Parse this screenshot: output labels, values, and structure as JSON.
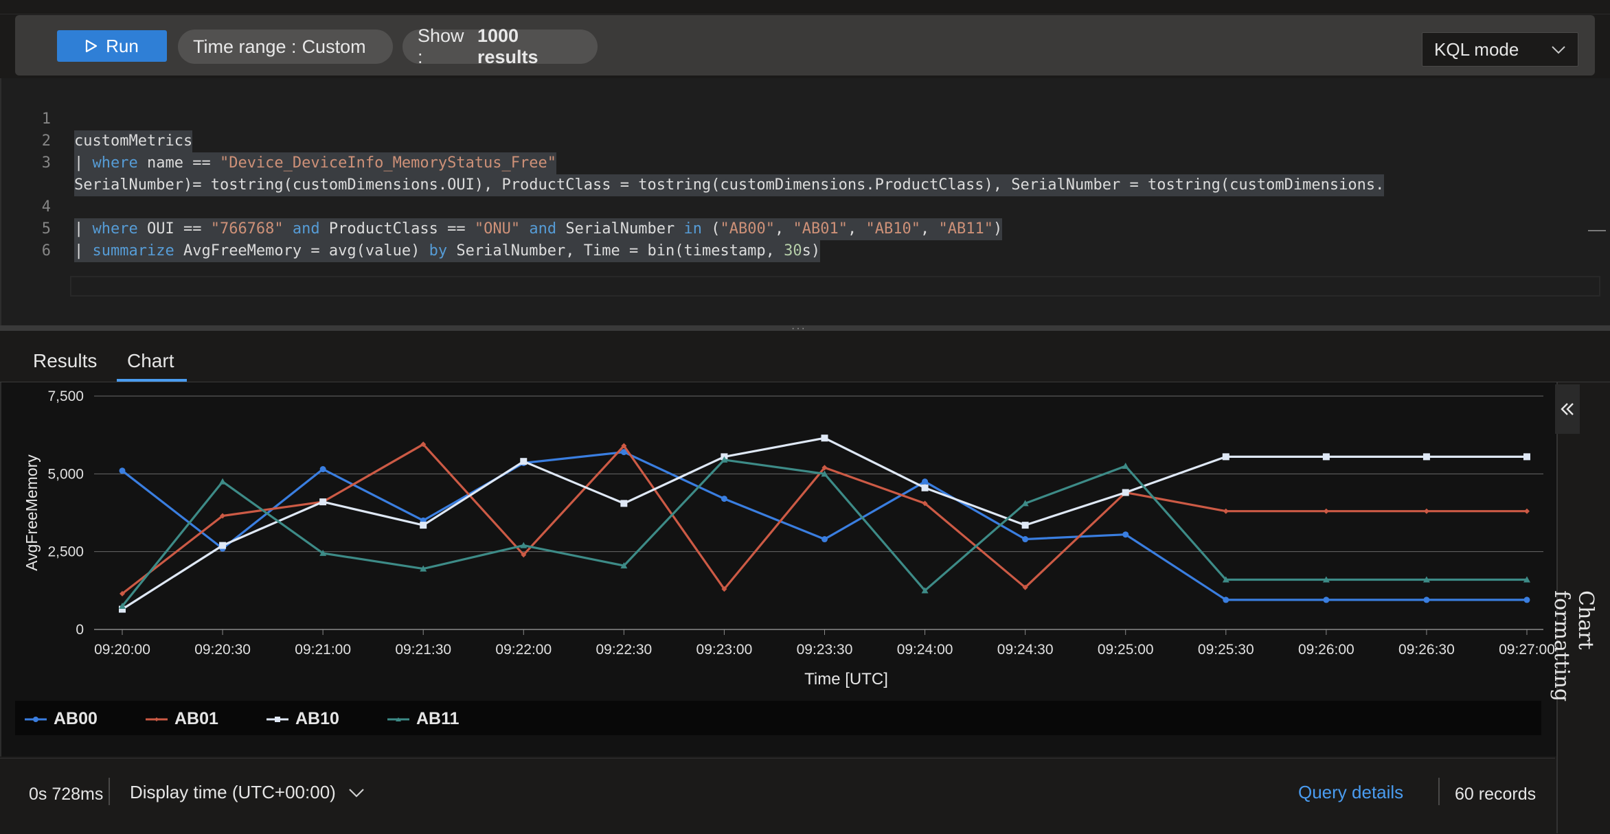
{
  "toolbar": {
    "run_label": "Run",
    "time_range_label": "Time range :",
    "time_range_value": "Custom",
    "show_label": "Show :",
    "show_value": "1000 results",
    "mode_value": "KQL mode"
  },
  "editor": {
    "line_numbers": [
      "1",
      "2",
      "3",
      "4",
      "5",
      "6"
    ],
    "code_lines": [
      "customMetrics",
      "| where name == \"Device_DeviceInfo_MemoryStatus_Free\"",
      "| extend OUI = tostring(customDimensions.OUI), ProductClass = tostring(customDimensions.ProductClass), SerialNumber = tostring(customDimensions.",
      "SerialNumber)",
      "| where OUI == \"766768\" and ProductClass == \"ONU\" and SerialNumber in (\"AB00\", \"AB01\", \"AB10\", \"AB11\")",
      "| summarize AvgFreeMemory = avg(value) by SerialNumber, Time = bin(timestamp, 30s)",
      ""
    ]
  },
  "tabs": [
    {
      "label": "Results",
      "active": false
    },
    {
      "label": "Chart",
      "active": true
    }
  ],
  "side_panel": {
    "label": "Chart formatting"
  },
  "status": {
    "duration": "0s 728ms",
    "display_time": "Display time (UTC+00:00)",
    "query_details": "Query details",
    "records": "60 records"
  },
  "chart_data": {
    "type": "line",
    "xlabel": "Time [UTC]",
    "ylabel": "AvgFreeMemory",
    "ylim": [
      0,
      7500
    ],
    "yticks": [
      "0",
      "2,500",
      "5,000",
      "7,500"
    ],
    "grid": true,
    "legend_position": "bottom",
    "categories": [
      "09:20:00",
      "09:20:30",
      "09:21:00",
      "09:21:30",
      "09:22:00",
      "09:22:30",
      "09:23:00",
      "09:23:30",
      "09:24:00",
      "09:24:30",
      "09:25:00",
      "09:25:30",
      "09:26:00",
      "09:26:30",
      "09:27:00"
    ],
    "series": [
      {
        "name": "AB00",
        "color": "#3a7ee0",
        "values": [
          5100,
          2600,
          5150,
          3500,
          5350,
          5700,
          4200,
          2900,
          4750,
          2900,
          3050,
          950,
          950,
          950,
          950
        ]
      },
      {
        "name": "AB01",
        "color": "#cc5a45",
        "values": [
          1150,
          3650,
          4100,
          5950,
          2400,
          5900,
          1300,
          5200,
          4050,
          1350,
          4400,
          3800,
          3800,
          3800,
          3800
        ]
      },
      {
        "name": "AB10",
        "color": "#dfe8f5",
        "values": [
          650,
          2700,
          4100,
          3350,
          5400,
          4050,
          5550,
          6150,
          4550,
          3350,
          4400,
          5550,
          5550,
          5550,
          5550
        ]
      },
      {
        "name": "AB11",
        "color": "#3d8b87",
        "values": [
          750,
          4750,
          2450,
          1950,
          2700,
          2050,
          5450,
          5000,
          1250,
          4050,
          5250,
          1600,
          1600,
          1600,
          1600
        ]
      }
    ]
  }
}
